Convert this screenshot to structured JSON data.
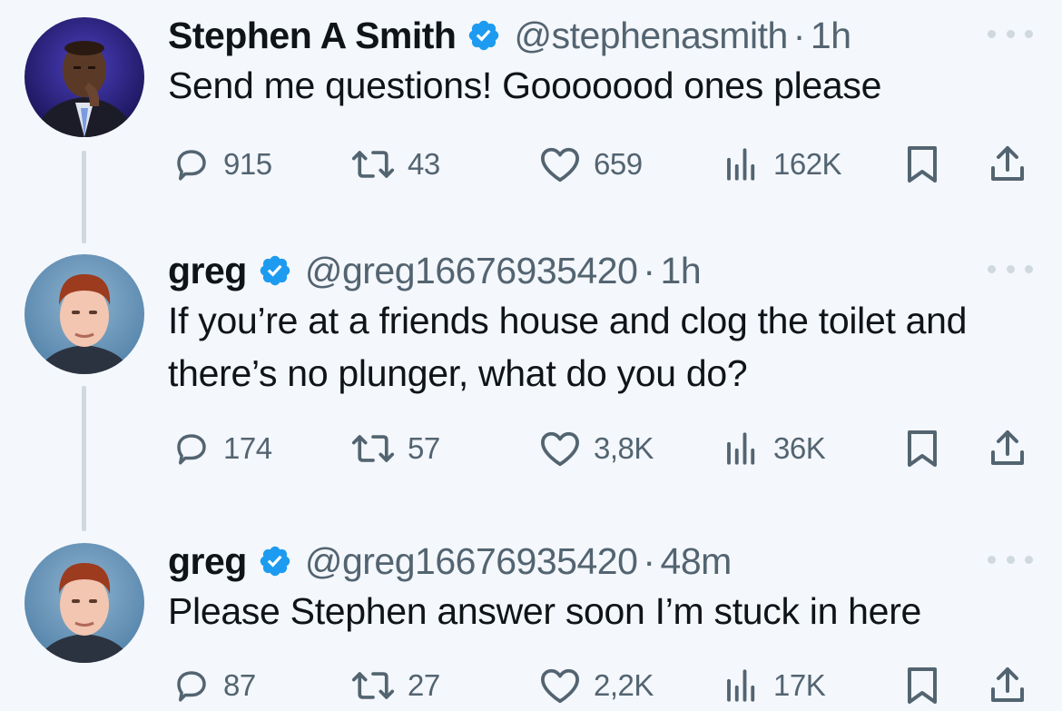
{
  "tweets": [
    {
      "name": "Stephen A Smith",
      "handle": "@stephenasmith",
      "separator": "·",
      "time": "1h",
      "text": "Send me questions! Gooooood ones please",
      "replies": "915",
      "retweets": "43",
      "likes": "659",
      "views": "162K",
      "avatar": "stephen-a-smith-avatar"
    },
    {
      "name": "greg",
      "handle": "@greg16676935420",
      "separator": "·",
      "time": "1h",
      "text": "If you’re at a friends house and clog the toilet and there’s no plunger, what do you do?",
      "replies": "174",
      "retweets": "57",
      "likes": "3,8K",
      "views": "36K",
      "avatar": "greg-avatar"
    },
    {
      "name": "greg",
      "handle": "@greg16676935420",
      "separator": "·",
      "time": "48m",
      "text": "Please Stephen answer soon I’m stuck in here",
      "replies": "87",
      "retweets": "27",
      "likes": "2,2K",
      "views": "17K",
      "avatar": "greg-avatar"
    }
  ],
  "icons": [
    "verified-badge-icon",
    "more-icon",
    "reply-icon",
    "retweet-icon",
    "like-icon",
    "views-icon",
    "bookmark-icon",
    "share-icon"
  ],
  "colors": {
    "background": "#f4f7fb",
    "text": "#0f1419",
    "secondary": "#536471",
    "verified": "#1d9bf0",
    "thread_line": "#cfd9de"
  }
}
